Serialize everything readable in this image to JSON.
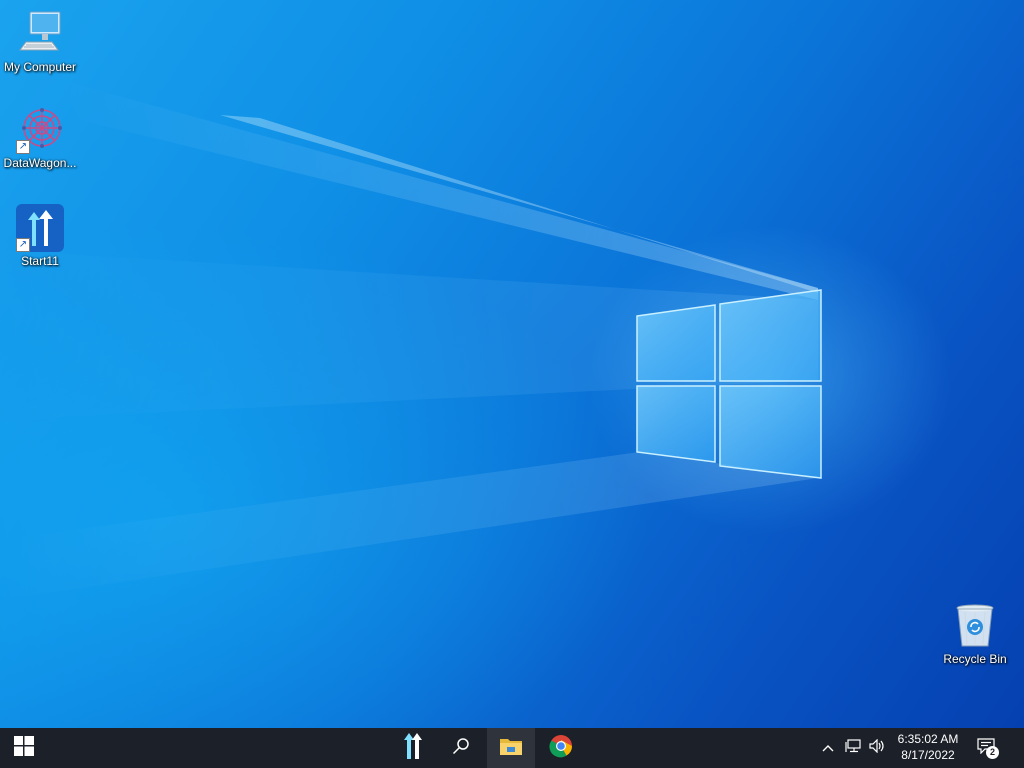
{
  "desktop": {
    "icons": [
      {
        "label": "My Computer",
        "icon": "computer-icon"
      },
      {
        "label": "DataWagon...",
        "icon": "datawagon-icon"
      },
      {
        "label": "Start11",
        "icon": "start11-icon"
      },
      {
        "label": "Recycle Bin",
        "icon": "recycle-bin-icon"
      }
    ],
    "wallpaper": {
      "accent": "#0b74d8",
      "glow": "#5ac8ff"
    }
  },
  "taskbar": {
    "background": "#1c2028",
    "start_icon": "windows-start-icon",
    "pinned": [
      {
        "name": "start11",
        "icon": "start11-icon"
      },
      {
        "name": "search",
        "icon": "search-icon"
      },
      {
        "name": "file-explorer",
        "icon": "folder-icon"
      },
      {
        "name": "chrome",
        "icon": "chrome-icon"
      }
    ],
    "tray": {
      "time": "6:35:02 AM",
      "date": "8/17/2022",
      "notification_count": "2"
    }
  }
}
